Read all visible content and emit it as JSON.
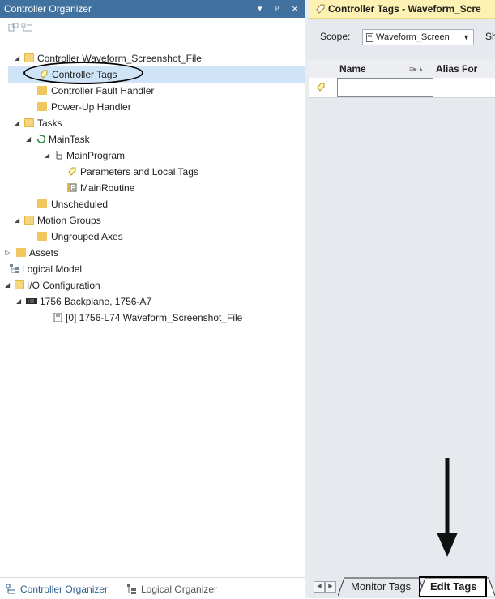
{
  "left_pane": {
    "title": "Controller Organizer",
    "title_buttons": {
      "dropdown": "▾",
      "pin": "ᵖ",
      "close": "×"
    },
    "tree": [
      {
        "id": "controller",
        "label": "Controller Waveform_Screenshot_File",
        "expander": "◢",
        "icon": "controller-folder-icon"
      },
      {
        "id": "controller-tags",
        "label": "Controller Tags",
        "icon": "tag-icon",
        "selected": true
      },
      {
        "id": "fault-handler",
        "label": "Controller Fault Handler",
        "icon": "folder-icon"
      },
      {
        "id": "powerup-handler",
        "label": "Power-Up Handler",
        "icon": "folder-icon"
      },
      {
        "id": "tasks",
        "label": "Tasks",
        "expander": "◢",
        "icon": "folder-open-icon"
      },
      {
        "id": "maintask",
        "label": "MainTask",
        "expander": "◢",
        "icon": "task-cycle-icon"
      },
      {
        "id": "mainprogram",
        "label": "MainProgram",
        "expander": "◢",
        "icon": "program-icon"
      },
      {
        "id": "params-local-tags",
        "label": "Parameters and Local Tags",
        "icon": "tag-icon"
      },
      {
        "id": "mainroutine",
        "label": "MainRoutine",
        "icon": "routine-icon"
      },
      {
        "id": "unscheduled",
        "label": "Unscheduled",
        "icon": "folder-icon"
      },
      {
        "id": "motion-groups",
        "label": "Motion Groups",
        "expander": "◢",
        "icon": "folder-open-icon"
      },
      {
        "id": "ungrouped-axes",
        "label": "Ungrouped Axes",
        "icon": "folder-icon"
      },
      {
        "id": "assets",
        "label": "Assets",
        "expander": "▷",
        "icon": "folder-icon"
      },
      {
        "id": "logical-model",
        "label": "Logical Model",
        "icon": "logical-model-icon"
      },
      {
        "id": "io-config",
        "label": "I/O Configuration",
        "expander": "◢",
        "icon": "folder-open-icon"
      },
      {
        "id": "backplane",
        "label": "1756 Backplane, 1756-A7",
        "expander": "◢",
        "icon": "backplane-icon"
      },
      {
        "id": "l74",
        "label": "[0] 1756-L74 Waveform_Screenshot_File",
        "icon": "controller-module-icon"
      }
    ],
    "bottom_tabs": [
      {
        "label": "Controller Organizer",
        "icon": "controller-organizer-icon"
      },
      {
        "label": "Logical Organizer",
        "icon": "logical-organizer-icon"
      }
    ]
  },
  "right_pane": {
    "title": "Controller Tags - Waveform_Scre",
    "scope_label": "Scope:",
    "scope_value": "Waveform_Screen",
    "show_label": "Sh",
    "columns": {
      "name": "Name",
      "alias": "Alias For"
    },
    "bottom_tabs": {
      "monitor": "Monitor Tags",
      "edit": "Edit Tags"
    }
  },
  "colors": {
    "title_bar": "#41719f",
    "editor_title_bg": "#fdf1b3",
    "selection": "#cfe4f7",
    "folder": "#f0c75e"
  }
}
